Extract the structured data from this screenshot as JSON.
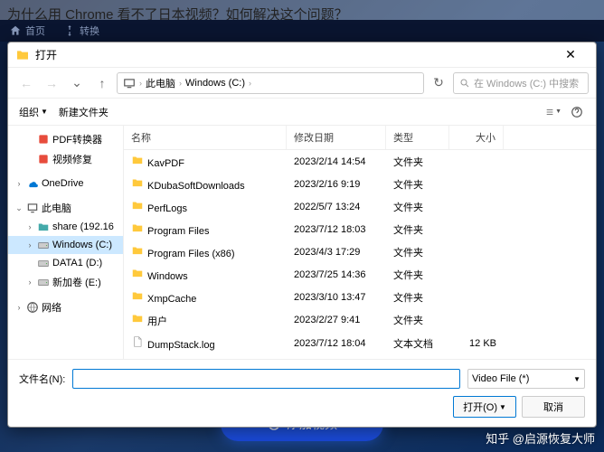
{
  "question": "为什么用 Chrome 看不了日本视频？如何解决这个问题？",
  "taskbar": {
    "home": "首页",
    "convert": "转换"
  },
  "dialog": {
    "title": "打开",
    "breadcrumb": [
      "此电脑",
      "Windows (C:)"
    ],
    "search_placeholder": "在 Windows (C:) 中搜索",
    "toolbar": {
      "organize": "组织",
      "new_folder": "新建文件夹"
    },
    "columns": {
      "name": "名称",
      "date": "修改日期",
      "type": "类型",
      "size": "大小"
    },
    "sidebar": [
      {
        "indent": 1,
        "icon": "app",
        "label": "PDF转换器"
      },
      {
        "indent": 1,
        "icon": "app",
        "label": "视频修复"
      },
      {
        "indent": 0,
        "icon": "spacer",
        "label": ""
      },
      {
        "indent": 0,
        "icon": "onedrive",
        "label": "OneDrive",
        "chevron": "›"
      },
      {
        "indent": 0,
        "icon": "spacer",
        "label": ""
      },
      {
        "indent": 0,
        "icon": "pc",
        "label": "此电脑",
        "chevron": "⌄"
      },
      {
        "indent": 1,
        "icon": "netfolder",
        "label": "share (192.16",
        "chevron": "›"
      },
      {
        "indent": 1,
        "icon": "disk",
        "label": "Windows (C:)",
        "chevron": "›",
        "selected": true
      },
      {
        "indent": 1,
        "icon": "disk",
        "label": "DATA1 (D:)"
      },
      {
        "indent": 1,
        "icon": "disk",
        "label": "新加卷 (E:)",
        "chevron": "›"
      },
      {
        "indent": 0,
        "icon": "spacer",
        "label": ""
      },
      {
        "indent": 0,
        "icon": "network",
        "label": "网络",
        "chevron": "›"
      }
    ],
    "files": [
      {
        "icon": "folder",
        "name": "KavPDF",
        "date": "2023/2/14 14:54",
        "type": "文件夹",
        "size": ""
      },
      {
        "icon": "folder",
        "name": "KDubaSoftDownloads",
        "date": "2023/2/16 9:19",
        "type": "文件夹",
        "size": ""
      },
      {
        "icon": "folder",
        "name": "PerfLogs",
        "date": "2022/5/7 13:24",
        "type": "文件夹",
        "size": ""
      },
      {
        "icon": "folder",
        "name": "Program Files",
        "date": "2023/7/12 18:03",
        "type": "文件夹",
        "size": ""
      },
      {
        "icon": "folder",
        "name": "Program Files (x86)",
        "date": "2023/4/3 17:29",
        "type": "文件夹",
        "size": ""
      },
      {
        "icon": "folder",
        "name": "Windows",
        "date": "2023/7/25 14:36",
        "type": "文件夹",
        "size": ""
      },
      {
        "icon": "folder",
        "name": "XmpCache",
        "date": "2023/3/10 13:47",
        "type": "文件夹",
        "size": ""
      },
      {
        "icon": "folder",
        "name": "用户",
        "date": "2023/2/27 9:41",
        "type": "文件夹",
        "size": ""
      },
      {
        "icon": "file",
        "name": "DumpStack.log",
        "date": "2023/7/12 18:04",
        "type": "文本文档",
        "size": "12 KB"
      }
    ],
    "filename_label": "文件名(N):",
    "filter_label": "Video File (*)",
    "open_btn": "打开(O)",
    "cancel_btn": "取消"
  },
  "add_video": "添加视频",
  "watermark": "知乎 @启源恢复大师"
}
